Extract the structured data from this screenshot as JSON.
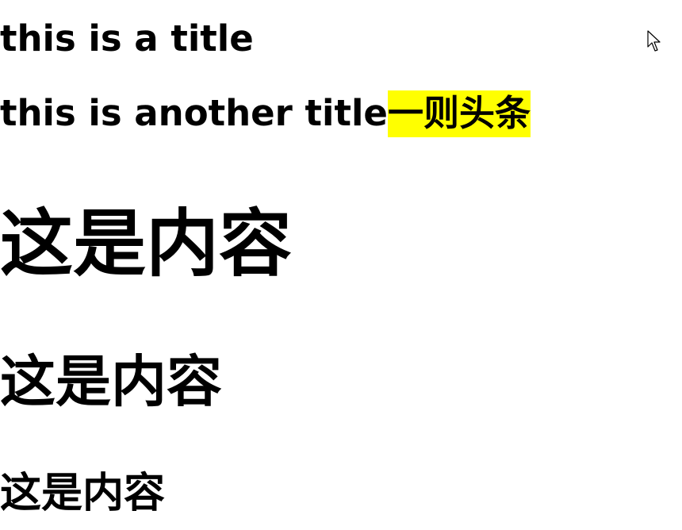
{
  "titles": {
    "title1": "this is a title",
    "title2_text": "this is another title",
    "title2_highlight": "一则头条"
  },
  "content": {
    "large": "这是内容",
    "medium": "这是内容",
    "small": "这是内容"
  },
  "colors": {
    "highlight": "#ffff00",
    "text": "#000000",
    "background": "#ffffff"
  },
  "icons": {
    "cursor": "mouse-pointer-icon"
  }
}
